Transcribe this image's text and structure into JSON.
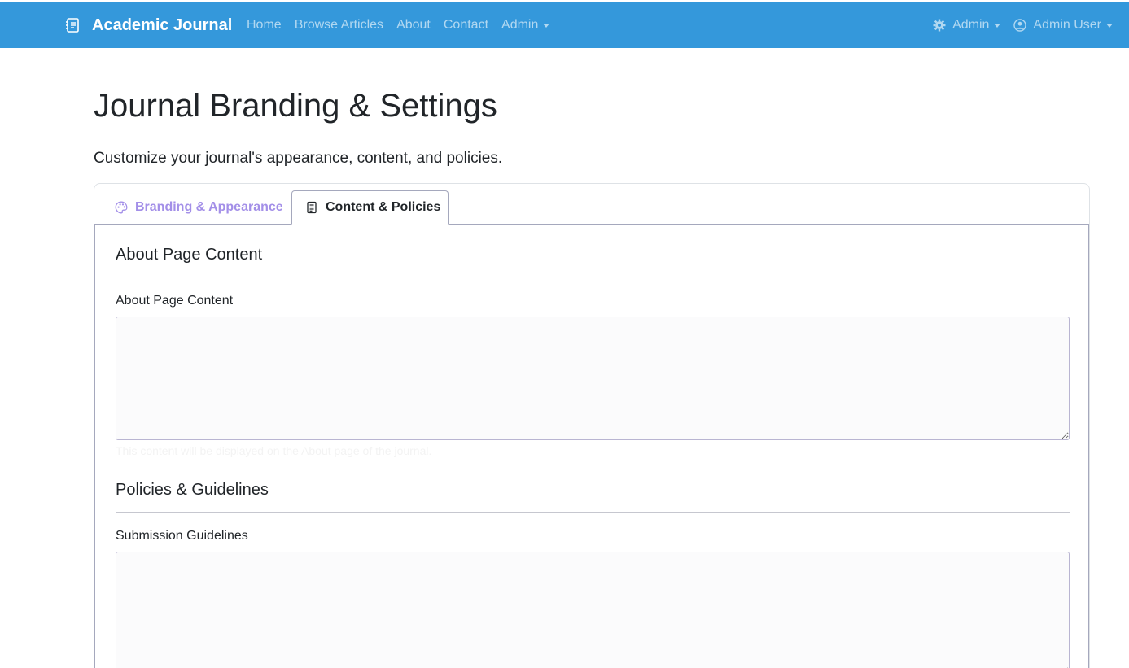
{
  "navbar": {
    "brand": "Academic Journal",
    "brand_icon": "journal-icon",
    "background": "#3498db",
    "links": [
      "Home",
      "Browse Articles",
      "About",
      "Contact"
    ],
    "admin_dropdown": "Admin",
    "right": {
      "admin_menu": "Admin",
      "admin_menu_icon": "gear-icon",
      "user_menu": "Admin User",
      "user_menu_icon": "user-circle-icon"
    }
  },
  "page": {
    "title": "Journal Branding & Settings",
    "subtitle": "Customize your journal's appearance, content, and policies."
  },
  "tabs": [
    {
      "label": "Branding & Appearance",
      "icon": "palette-icon",
      "active": false,
      "color": "#a38fe8"
    },
    {
      "label": "Content & Policies",
      "icon": "document-icon",
      "active": true
    }
  ],
  "sections": {
    "about": {
      "title": "About Page Content",
      "field_label": "About Page Content",
      "value": "",
      "help": "This content will be displayed on the About page of the journal."
    },
    "policies": {
      "title": "Policies & Guidelines",
      "field_label": "Submission Guidelines",
      "value": ""
    }
  }
}
